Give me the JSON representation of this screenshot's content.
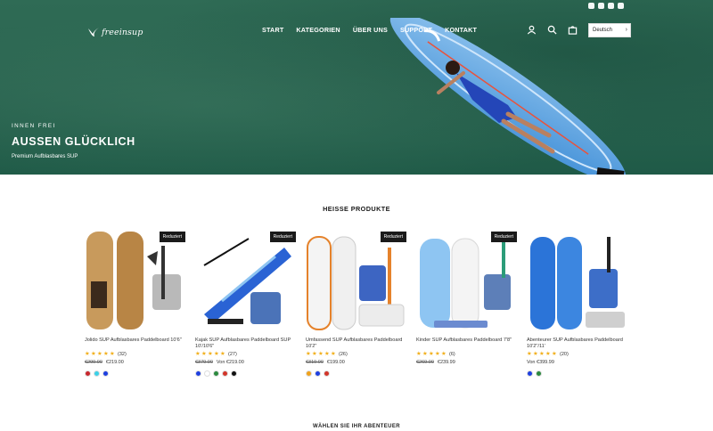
{
  "header": {
    "logo_text": "freeinsup",
    "nav": [
      "START",
      "KATEGORIEN",
      "ÜBER UNS",
      "SUPPORT",
      "KONTAKT"
    ],
    "icons": [
      "account-icon",
      "search-icon",
      "cart-icon"
    ],
    "language_selector": "Deutsch",
    "social_icons": [
      "instagram-icon",
      "facebook-icon",
      "youtube-icon",
      "pinterest-icon"
    ]
  },
  "hero": {
    "eyebrow": "INNEN FREI",
    "headline": "AUSSEN GLÜCKLICH",
    "subtitle": "Premium Aufblasbares SUP"
  },
  "section_title": "HEISSE PRODUKTE",
  "products": [
    {
      "badge": "Reduziert",
      "name": "Jolido SUP Aufblasbares Paddelboard 10'6\"",
      "rating_count": "(32)",
      "old_price": "€299.00",
      "price": "€219.00",
      "swatches": [
        "#c8272d",
        "#3bd1e8",
        "#1e3fe0"
      ]
    },
    {
      "badge": "Reduziert",
      "name": "Kajak SUP Aufblasbares Paddelboard SUP 10'/10'6\"",
      "rating_count": "(27)",
      "old_price": "€379.00",
      "price": "Von €219.00",
      "swatches": [
        "#1e3fe0",
        "#ffffff",
        "#2b8a3e",
        "#d2352a",
        "#111111"
      ]
    },
    {
      "badge": "Reduziert",
      "name": "Umfassend SUP Aufblasbares Paddelboard 10'2\"",
      "rating_count": "(26)",
      "old_price": "€319.00",
      "price": "€199.00",
      "swatches": [
        "#f0a21b",
        "#1e3fe0",
        "#d2352a"
      ]
    },
    {
      "badge": "Reduziert",
      "name": "Kinder SUP Aufblasbares Paddelboard 7'8\"",
      "rating_count": "(6)",
      "old_price": "€269.00",
      "price": "€239.99",
      "swatches": []
    },
    {
      "badge": "",
      "name": "Abenteurer SUP Aufblasbares Paddelboard 10'2\"/11'",
      "rating_count": "(20)",
      "old_price": "",
      "price": "Von €399.99",
      "swatches": [
        "#1e3fe0",
        "#2b8a3e"
      ]
    }
  ],
  "next_section_title": "WÄHLEN SIE IHR ABENTEUER",
  "colors": {
    "hero_water": "#2a6450",
    "badge_bg": "#1a1a1a",
    "star": "#f2b01e"
  }
}
